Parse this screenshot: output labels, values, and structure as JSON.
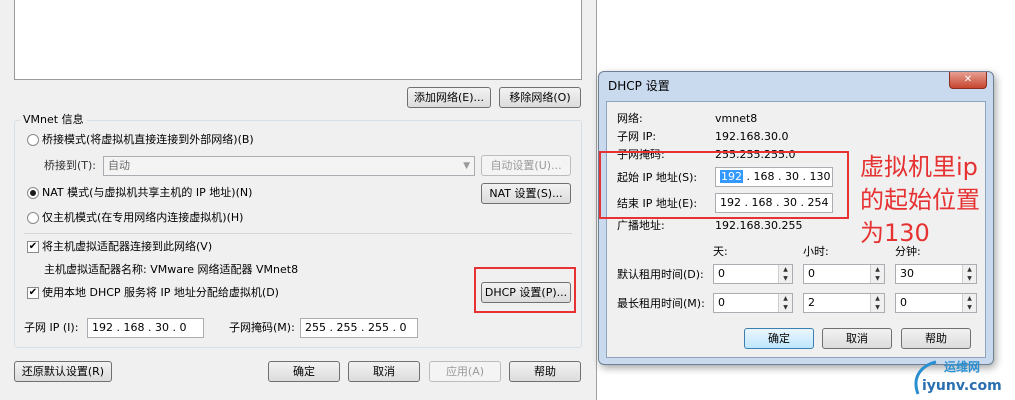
{
  "main_dialog": {
    "add_network_label": "添加网络(E)...",
    "remove_network_label": "移除网络(O)",
    "vmnet_info_title": "VMnet 信息",
    "bridge_mode_label": "桥接模式(将虚拟机直接连接到外部网络)(B)",
    "bridge_to_label": "桥接到(T):",
    "bridge_to_value": "自动",
    "auto_settings_label": "自动设置(U)...",
    "nat_mode_label": "NAT 模式(与虚拟机共享主机的 IP 地址)(N)",
    "nat_settings_label": "NAT 设置(S)...",
    "host_only_label": "仅主机模式(在专用网络内连接虚拟机)(H)",
    "connect_host_adapter_label": "将主机虚拟适配器连接到此网络(V)",
    "host_adapter_name": "主机虚拟适配器名称: VMware 网络适配器 VMnet8",
    "use_dhcp_label": "使用本地 DHCP 服务将 IP 地址分配给虚拟机(D)",
    "dhcp_settings_label": "DHCP 设置(P)...",
    "subnet_ip_label": "子网 IP (I):",
    "subnet_ip_value": "192 . 168 . 30 . 0",
    "subnet_mask_label": "子网掩码(M):",
    "subnet_mask_value": "255 . 255 . 255 . 0",
    "restore_defaults_label": "还原默认设置(R)",
    "ok_label": "确定",
    "cancel_label": "取消",
    "apply_label": "应用(A)",
    "help_label": "帮助"
  },
  "dhcp_dialog": {
    "title": "DHCP 设置",
    "network_label": "网络:",
    "network_value": "vmnet8",
    "subnet_ip_label": "子网 IP:",
    "subnet_ip_value": "192.168.30.0",
    "subnet_mask_label": "子网掩码:",
    "subnet_mask_value": "255.255.255.0",
    "start_ip_label": "起始 IP 地址(S):",
    "start_ip_prefix": "192",
    "start_ip_rest": ". 168 . 30 . 130",
    "end_ip_label": "结束 IP 地址(E):",
    "end_ip_value": "192 . 168 . 30 . 254",
    "broadcast_label": "广播地址:",
    "broadcast_value": "192.168.30.255",
    "col_days": "天:",
    "col_hours": "小时:",
    "col_minutes": "分钟:",
    "default_lease_label": "默认租用时间(D):",
    "default_lease": [
      "0",
      "0",
      "30"
    ],
    "max_lease_label": "最长租用时间(M):",
    "max_lease": [
      "0",
      "2",
      "0"
    ],
    "ok_label": "确定",
    "cancel_label": "取消",
    "help_label": "帮助",
    "close_glyph": "✕"
  },
  "annotation": {
    "line1": "虚拟机里ip",
    "line2": "的起始位置",
    "line3": "为130",
    "color": "#e63232"
  },
  "watermark": {
    "line1": "运维网",
    "line2": "iyunv.com"
  }
}
